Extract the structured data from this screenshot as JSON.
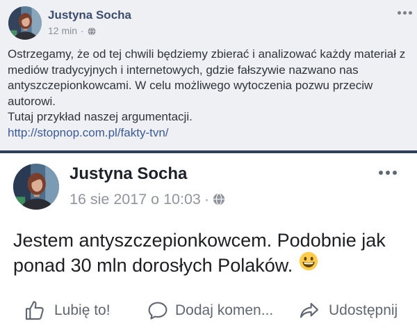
{
  "posts": [
    {
      "author": "Justyna Socha",
      "timestamp": "12 min",
      "separator": "·",
      "privacy_icon": "globe-icon",
      "menu_icon": "more-options-icon",
      "body_lines": [
        "Ostrzegamy, że od tej chwili będziemy zbierać i analizować każdy materiał z",
        "mediów tradycyjnych i internetowych, gdzie fałszywie nazwano nas",
        "antyszczepionkowcami. W celu możliwego wytoczenia pozwu przeciw",
        "autorowi.",
        "Tutaj przykład naszej argumentacji."
      ],
      "link": "http://stopnop.com.pl/fakty-tvn/"
    },
    {
      "author": "Justyna Socha",
      "timestamp": "16 sie 2017 o 10:03",
      "separator": "·",
      "privacy_icon": "globe-icon",
      "menu_icon": "more-options-icon",
      "body_lines": [
        "Jestem antyszczepionkowcem. Podobnie jak",
        "ponad 30 mln dorosłych Polaków."
      ],
      "body_emoji_icon": "grinning-face-icon",
      "actions": [
        {
          "label": "Lubię to!",
          "icon": "like-icon"
        },
        {
          "label": "Dodaj komen...",
          "icon": "comment-icon"
        },
        {
          "label": "Udostępnij",
          "icon": "share-icon"
        }
      ]
    }
  ],
  "colors": {
    "link": "#3b5998",
    "action_text": "#606770",
    "meta_text": "#90949c"
  }
}
